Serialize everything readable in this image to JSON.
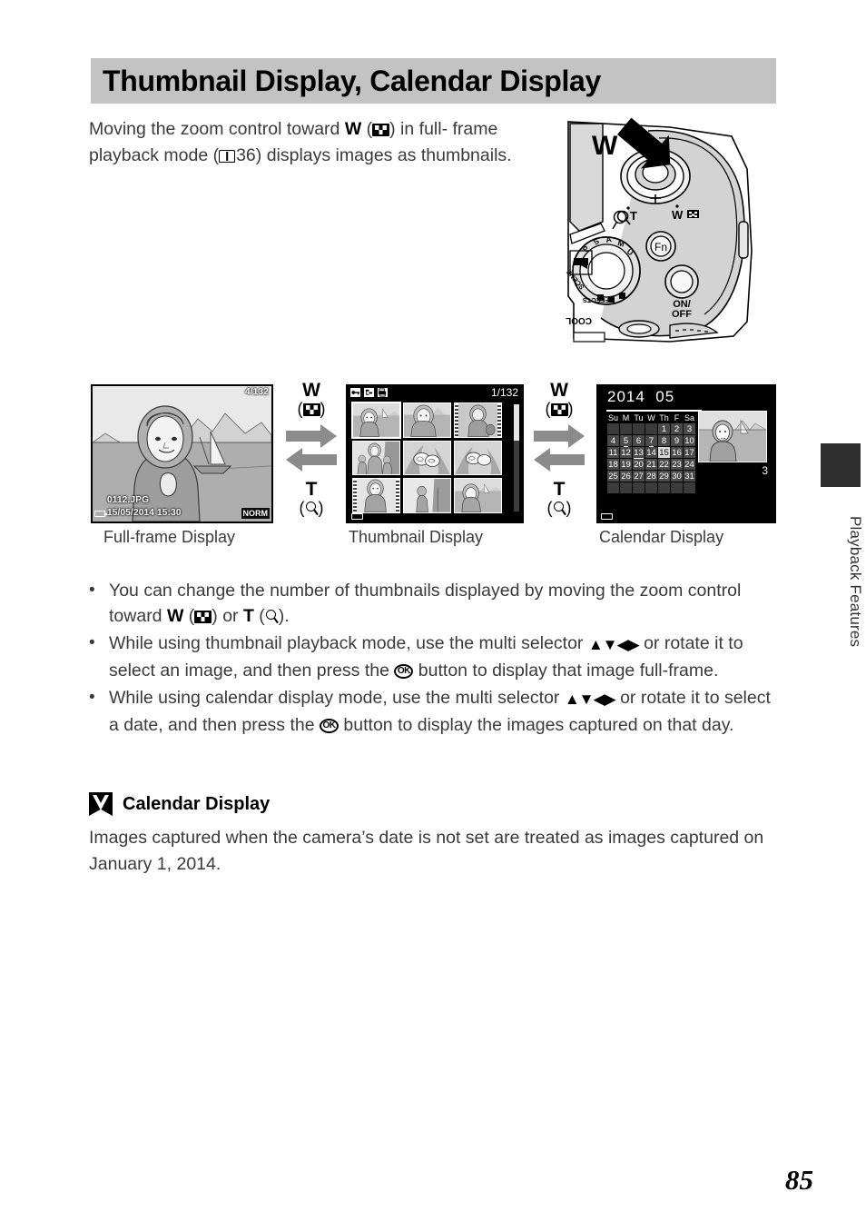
{
  "page": {
    "number": "85",
    "side_tab": "Playback Features"
  },
  "header": {
    "title": "Thumbnail Display, Calendar Display"
  },
  "intro": {
    "part1": "Moving the zoom control toward ",
    "w_label": "W",
    "paren_open": " (",
    "paren_close": ") in full-",
    "part2": "frame playback mode (",
    "ref_page": "36",
    "part3": ") displays images as",
    "part4": "thumbnails."
  },
  "camera_figure": {
    "w_marker": "W",
    "zoom_t_label": "T",
    "zoom_w_label": "W",
    "fn_label": "Fn",
    "power_label_line1": "ON/",
    "power_label_line2": "OFF",
    "mode_dial_labels": [
      "P",
      "S",
      "A",
      "M",
      "U",
      "EFFECTS",
      "SCENE"
    ]
  },
  "flow": {
    "zoom_w_label": "W",
    "zoom_t_label": "T",
    "labels": {
      "fullframe": "Full-frame Display",
      "thumbnail": "Thumbnail Display",
      "calendar": "Calendar Display"
    }
  },
  "fullframe_screen": {
    "counter": "4/132",
    "filename": "0112.JPG",
    "datetime": "15/05/2014  15:30",
    "quality": "NORM",
    "battery_icon": "battery-icon"
  },
  "thumbnail_screen": {
    "counter": "1/132",
    "icons": [
      "protect-icon",
      "transfer-icon",
      "print-icon"
    ],
    "cells": [
      {
        "selected": true,
        "film": false
      },
      {
        "selected": false,
        "film": false
      },
      {
        "selected": false,
        "film": true
      },
      {
        "selected": false,
        "film": false
      },
      {
        "selected": false,
        "film": false
      },
      {
        "selected": false,
        "film": false
      },
      {
        "selected": false,
        "film": true
      },
      {
        "selected": false,
        "film": false
      },
      {
        "selected": false,
        "film": false
      }
    ]
  },
  "calendar_screen": {
    "year": "2014",
    "month": "05",
    "weekday_headers": [
      "Su",
      "M",
      "Tu",
      "W",
      "Th",
      "F",
      "Sa"
    ],
    "weeks": [
      [
        "",
        "",
        "",
        "",
        "1",
        "2",
        "3"
      ],
      [
        "4",
        "5",
        "6",
        "7",
        "8",
        "9",
        "10"
      ],
      [
        "11",
        "12",
        "13",
        "14",
        "15",
        "16",
        "17"
      ],
      [
        "18",
        "19",
        "20",
        "21",
        "22",
        "23",
        "24"
      ],
      [
        "25",
        "26",
        "27",
        "28",
        "29",
        "30",
        "31"
      ],
      [
        "",
        "",
        "",
        "",
        "",
        "",
        ""
      ]
    ],
    "days_with_images": [
      "5",
      "7",
      "13",
      "15"
    ],
    "selected_day": "15",
    "image_count": "3"
  },
  "bullets": [
    {
      "dot": "•",
      "seg1": "You can change the number of thumbnails displayed by moving the zoom control toward ",
      "w": "W",
      "seg2": " (",
      "seg3": ") or ",
      "t": "T",
      "seg4": " (",
      "seg5": ")."
    },
    {
      "dot": "•",
      "seg1": "While using thumbnail playback mode, use the multi selector ",
      "arrows": "▲▼◀▶",
      "seg2": " or rotate it to select an image, and then press the ",
      "ok": "OK",
      "seg3": " button to display that image full-frame."
    },
    {
      "dot": "•",
      "seg1": "While using calendar display mode, use the multi selector ",
      "arrows": "▲▼◀▶",
      "seg2": " or rotate it to select a date, and then press the ",
      "ok": "OK",
      "seg3": " button to display the images captured on that day."
    }
  ],
  "note": {
    "heading": "Calendar Display",
    "body": "Images captured when the camera’s date is not set are treated as images captured on January 1, 2014."
  }
}
